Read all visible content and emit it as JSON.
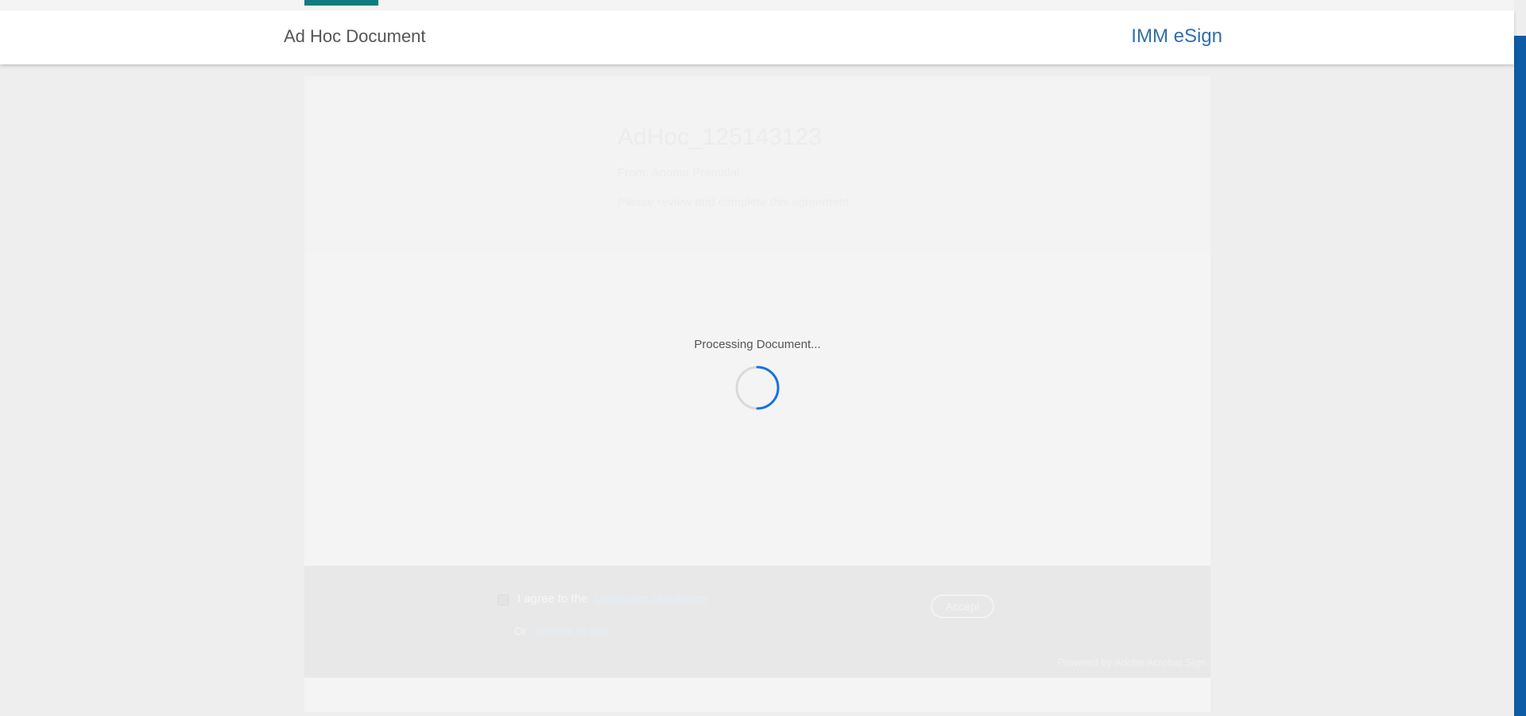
{
  "top_bar": {
    "active_tab_color": "#0f7b80"
  },
  "header": {
    "title": "Ad Hoc Document",
    "brand": "IMM eSign",
    "brand_color": "#2e6fae"
  },
  "document": {
    "name": "AdHoc_125143123",
    "from": "From: Anoma Premalal",
    "instructions": "Please review and complete this agreement."
  },
  "loading": {
    "label": "Processing Document...",
    "spinner_color": "#1473e6"
  },
  "footer": {
    "agree_prefix": "I agree to the",
    "agree_link": "Consumer Disclosure",
    "accept_label": "Accept",
    "or_label": "Or",
    "decline_link": "Decline to sign",
    "powered_by": "Powered by Adobe Acrobat Sign"
  }
}
